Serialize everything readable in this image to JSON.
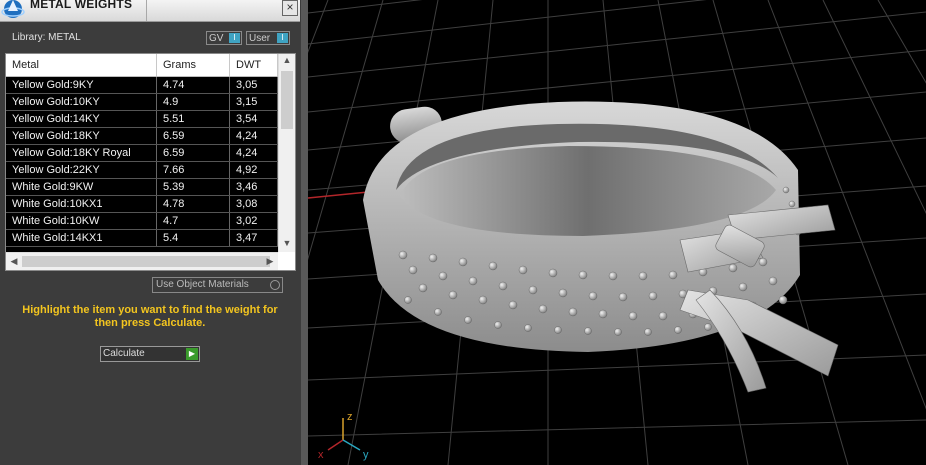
{
  "panel": {
    "title": "METAL WEIGHTS",
    "close_label": "×",
    "library_label": "Library: METAL",
    "toggles": [
      {
        "label": "GV",
        "indicator": "I"
      },
      {
        "label": "User",
        "indicator": "I"
      }
    ],
    "table": {
      "headers": [
        "Metal",
        "Grams",
        "DWT"
      ],
      "rows": [
        [
          "Yellow Gold:9KY",
          "4.74",
          "3,05"
        ],
        [
          "Yellow Gold:10KY",
          "4.9",
          "3,15"
        ],
        [
          "Yellow Gold:14KY",
          "5.51",
          "3,54"
        ],
        [
          "Yellow Gold:18KY",
          "6.59",
          "4,24"
        ],
        [
          "Yellow Gold:18KY Royal",
          "6.59",
          "4,24"
        ],
        [
          "Yellow Gold:22KY",
          "7.66",
          "4,92"
        ],
        [
          "White Gold:9KW",
          "5.39",
          "3,46"
        ],
        [
          "White Gold:10KX1",
          "4.78",
          "3,08"
        ],
        [
          "White Gold:10KW",
          "4.7",
          "3,02"
        ],
        [
          "White Gold:14KX1",
          "5.4",
          "3,47"
        ]
      ]
    },
    "use_object_materials": "Use Object Materials",
    "instruction": "Highlight the item you want to find the weight for then press Calculate.",
    "calculate_label": "Calculate"
  },
  "viewport": {
    "axis_labels": {
      "x": "x",
      "y": "y",
      "z": "z"
    },
    "colors": {
      "grid": "#3f3f3f",
      "axis_x": "#b3262a",
      "axis_y": "#2aa7c0",
      "axis_z": "#d7a12a",
      "ring": "#c8c8c8"
    }
  }
}
